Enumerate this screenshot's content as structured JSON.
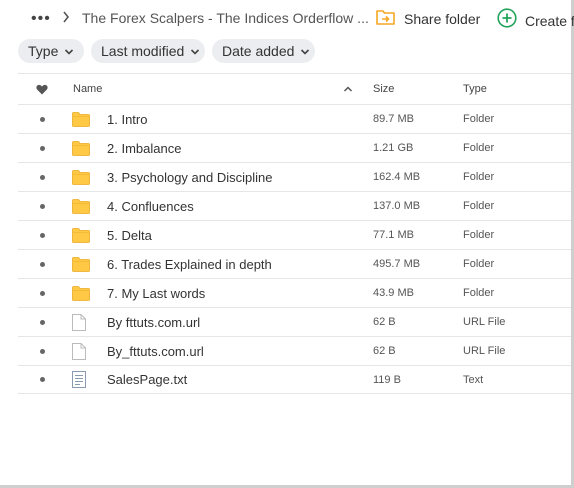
{
  "breadcrumb": {
    "more_icon": "ellipsis",
    "current_folder": "The Forex Scalpers - The Indices Orderflow ..."
  },
  "toolbar": {
    "share_label": "Share folder",
    "share_icon": "share-folder-icon",
    "create_label": "Create f",
    "create_icon": "plus-circle-icon",
    "accent_color": "#f5a623",
    "create_color": "#22a35a"
  },
  "filters": [
    {
      "label": "Type"
    },
    {
      "label": "Last modified"
    },
    {
      "label": "Date added"
    }
  ],
  "table": {
    "headers": {
      "name": "Name",
      "size": "Size",
      "type": "Type"
    },
    "rows": [
      {
        "name": "1. Intro",
        "size": "89.7 MB",
        "type": "Folder",
        "icon": "folder"
      },
      {
        "name": "2. Imbalance",
        "size": "1.21 GB",
        "type": "Folder",
        "icon": "folder"
      },
      {
        "name": "3. Psychology and Discipline",
        "size": "162.4 MB",
        "type": "Folder",
        "icon": "folder"
      },
      {
        "name": "4. Confluences",
        "size": "137.0 MB",
        "type": "Folder",
        "icon": "folder"
      },
      {
        "name": "5. Delta",
        "size": "77.1 MB",
        "type": "Folder",
        "icon": "folder"
      },
      {
        "name": "6. Trades Explained in depth",
        "size": "495.7 MB",
        "type": "Folder",
        "icon": "folder"
      },
      {
        "name": "7. My Last words",
        "size": "43.9 MB",
        "type": "Folder",
        "icon": "folder"
      },
      {
        "name": "By fttuts.com.url",
        "size": "62 B",
        "type": "URL File",
        "icon": "file"
      },
      {
        "name": "By_fttuts.com.url",
        "size": "62 B",
        "type": "URL File",
        "icon": "file"
      },
      {
        "name": "SalesPage.txt",
        "size": "119 B",
        "type": "Text",
        "icon": "text-file"
      }
    ]
  }
}
